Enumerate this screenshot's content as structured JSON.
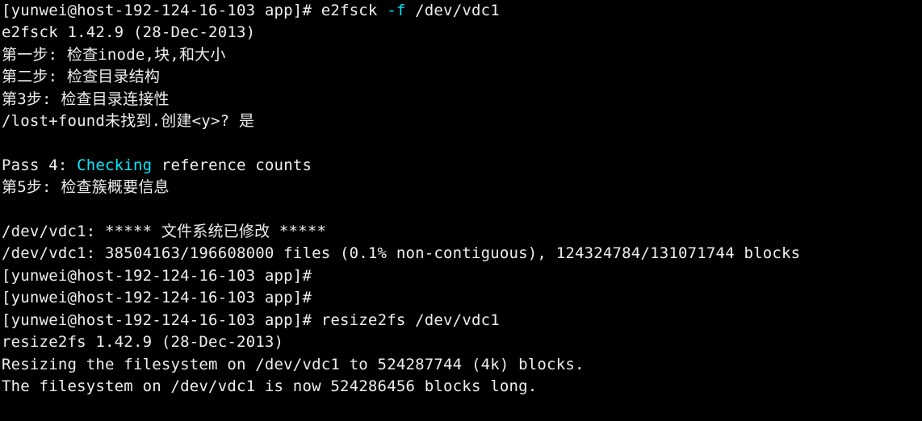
{
  "prompt1": {
    "prefix": "[yunwei@host-192-124-16-103 app]# ",
    "cmd": "e2fsck ",
    "flag": "-f",
    "arg": " /dev/vdc1"
  },
  "l2": "e2fsck 1.42.9 (28-Dec-2013)",
  "l3": "第一步: 检查inode,块,和大小",
  "l4": "第二步: 检查目录结构",
  "l5": "第3步: 检查目录连接性",
  "l6": "/lost+found未找到.创建<y>? 是",
  "l7": "",
  "l8a": "Pass 4: ",
  "l8b": "Checking",
  "l8c": " reference counts",
  "l9": "第5步: 检查簇概要信息",
  "l10": "",
  "l11": "/dev/vdc1: ***** 文件系统已修改 *****",
  "l12": "/dev/vdc1: 38504163/196608000 files (0.1% non-contiguous), 124324784/131071744 blocks",
  "prompt2": "[yunwei@host-192-124-16-103 app]# ",
  "prompt3": "[yunwei@host-192-124-16-103 app]# ",
  "prompt4": {
    "prefix": "[yunwei@host-192-124-16-103 app]# ",
    "cmd": "resize2fs /dev/vdc1"
  },
  "l16": "resize2fs 1.42.9 (28-Dec-2013)",
  "l17": "Resizing the filesystem on /dev/vdc1 to 524287744 (4k) blocks.",
  "l18": "The filesystem on /dev/vdc1 is now 524286456 blocks long."
}
